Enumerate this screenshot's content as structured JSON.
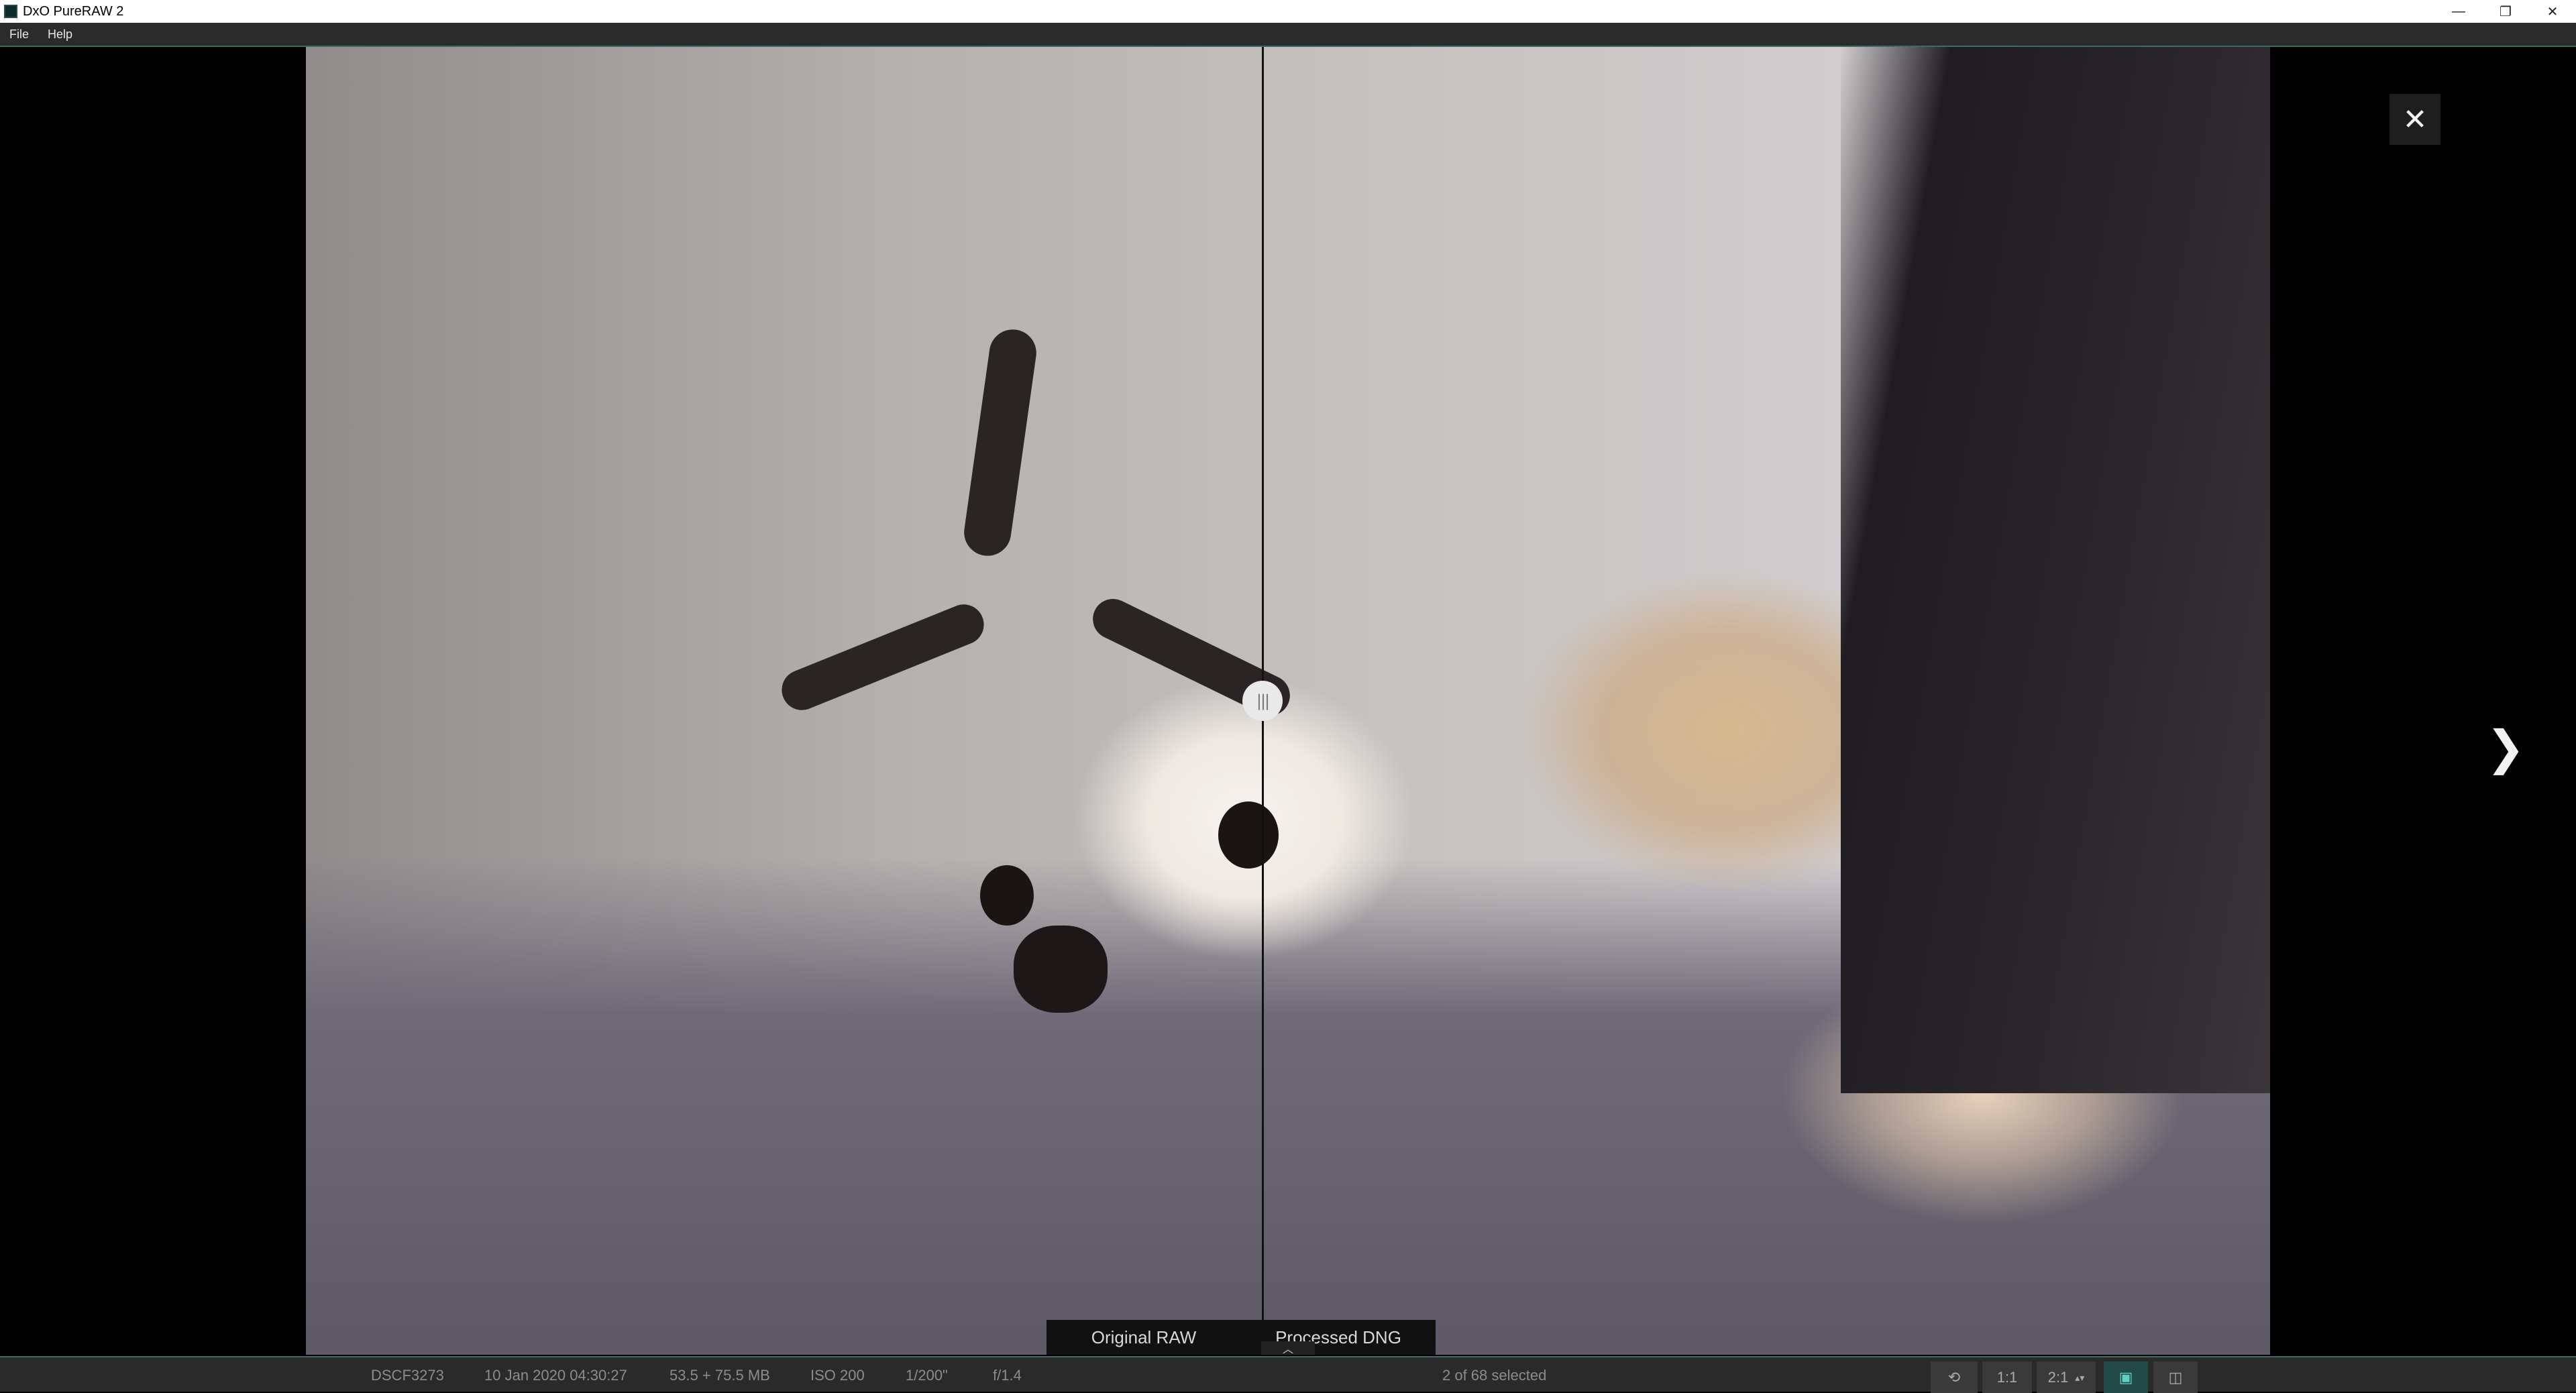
{
  "window": {
    "title": "DxO PureRAW 2",
    "controls": {
      "minimize": "—",
      "restore": "❐",
      "close": "✕"
    }
  },
  "menu": {
    "items": [
      "File",
      "Help"
    ]
  },
  "viewer": {
    "compare": {
      "left_label": "Original RAW",
      "right_label": "Processed DNG"
    },
    "split_handle_glyph": "|||",
    "close_glyph": "✕",
    "next_glyph": "❯",
    "collapse_glyph": "︿"
  },
  "status": {
    "filename": "DSCF3273",
    "date": "10 Jan 2020 04:30:27",
    "size": "53.5 + 75.5 MB",
    "iso": "ISO 200",
    "shutter": "1/200\"",
    "aperture": "f/1.4",
    "selection": "2 of 68 selected"
  },
  "toolbar": {
    "zoom_1_1": "1:1",
    "zoom_2_1": "2:1",
    "spinner": "▴▾"
  },
  "icons": {
    "close": "close-icon",
    "next": "chevron-right-icon",
    "handle": "split-handle-icon",
    "image_view": "image-view-icon",
    "compare_view": "compare-view-icon"
  },
  "colors": {
    "accent": "#3a6b64",
    "active_tool": "#5fd1c2"
  }
}
